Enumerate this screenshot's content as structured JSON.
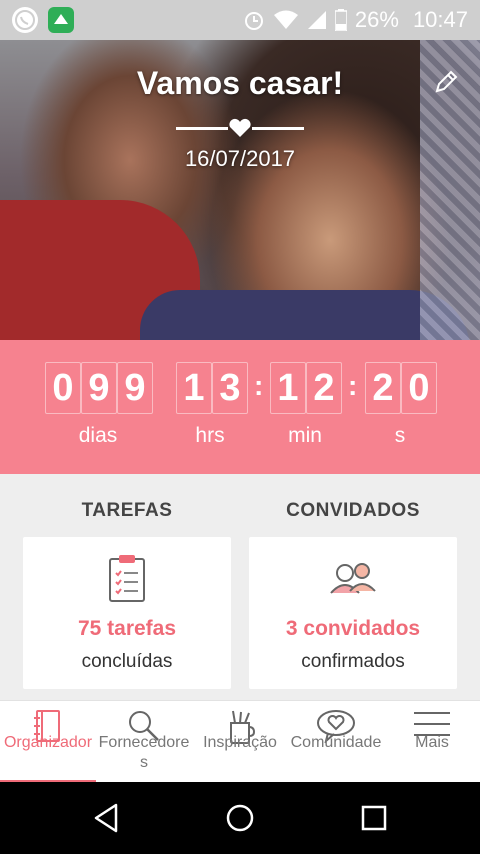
{
  "status_bar": {
    "battery": "26%",
    "time": "10:47",
    "icons": [
      "whatsapp-icon",
      "casamentos-app-icon",
      "alarm-icon",
      "wifi-icon",
      "signal-icon",
      "battery-icon"
    ]
  },
  "hero": {
    "title": "Vamos casar!",
    "date": "16/07/2017"
  },
  "countdown": {
    "days": [
      "0",
      "9",
      "9"
    ],
    "hours": [
      "1",
      "3"
    ],
    "minutes": [
      "1",
      "2"
    ],
    "seconds": [
      "2",
      "0"
    ],
    "labels": {
      "days": "dias",
      "hours": "hrs",
      "minutes": "min",
      "seconds": "s"
    }
  },
  "tasks": {
    "title": "TAREFAS",
    "value": "75 tarefas",
    "subtitle": "concluídas"
  },
  "guests": {
    "title": "CONVIDADOS",
    "value": "3 convidados",
    "subtitle": "confirmados"
  },
  "bottom_nav": {
    "items": [
      {
        "label": "Organizador",
        "icon": "notebook-icon",
        "active": true
      },
      {
        "label": "Fornecedores",
        "icon": "search-icon",
        "active": false
      },
      {
        "label": "Inspiração",
        "icon": "pencil-cup-icon",
        "active": false
      },
      {
        "label": "Comunidade",
        "icon": "heart-bubble-icon",
        "active": false
      },
      {
        "label": "Mais",
        "icon": "menu-icon",
        "active": false
      }
    ]
  },
  "colors": {
    "accent": "#f6828f",
    "accent_text": "#ef6b78",
    "status_bar": "#cfcfcf"
  }
}
